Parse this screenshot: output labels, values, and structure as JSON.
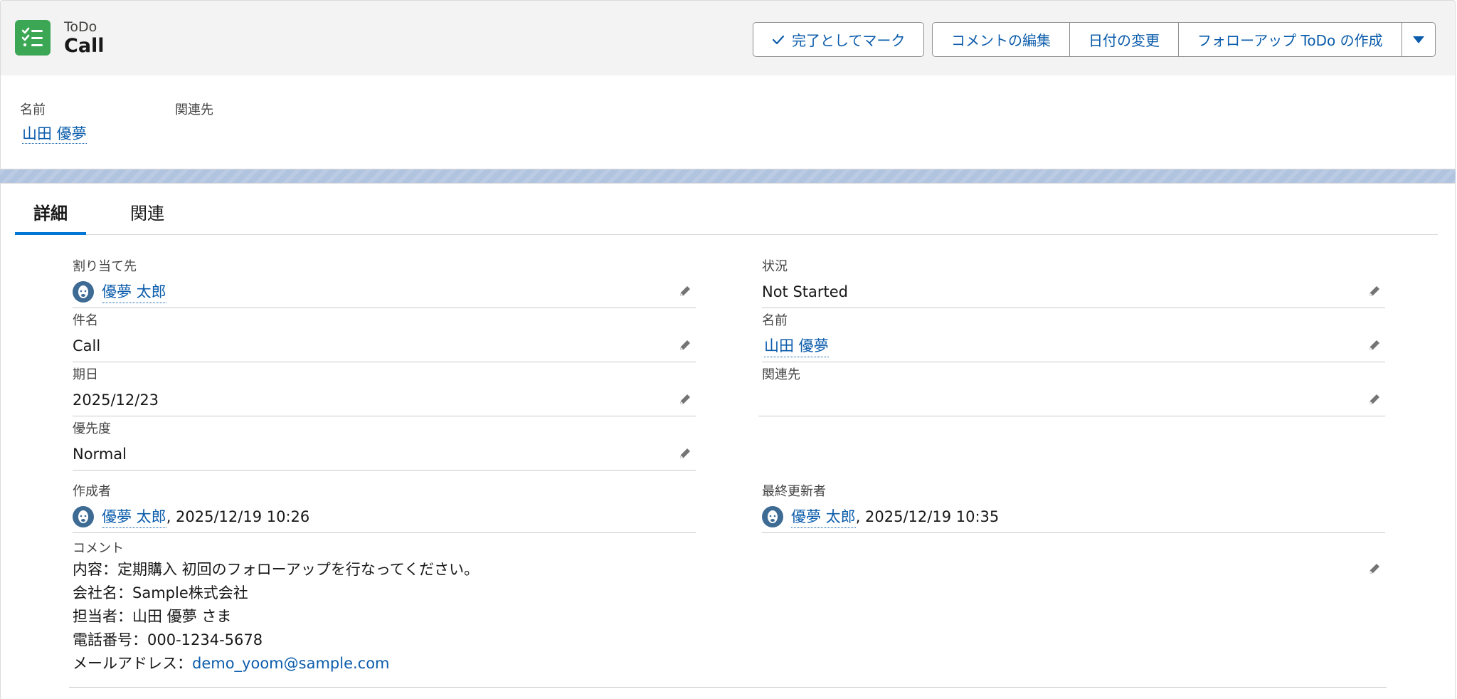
{
  "header": {
    "object_type": "ToDo",
    "title": "Call",
    "icon": "task-list-icon",
    "buttons": {
      "mark_complete": "完了としてマーク",
      "edit_comments": "コメントの編集",
      "change_date": "日付の変更",
      "create_followup": "フォローアップ ToDo の作成"
    }
  },
  "highlights": {
    "name_label": "名前",
    "name_value": "山田 優夢",
    "related_label": "関連先",
    "related_value": ""
  },
  "tabs": [
    "詳細",
    "関連"
  ],
  "details": {
    "assigned_to": {
      "label": "割り当て先",
      "value": "優夢 太郎"
    },
    "status": {
      "label": "状況",
      "value": "Not Started"
    },
    "subject": {
      "label": "件名",
      "value": "Call"
    },
    "name": {
      "label": "名前",
      "value": "山田 優夢"
    },
    "due_date": {
      "label": "期日",
      "value": "2025/12/23"
    },
    "related_to": {
      "label": "関連先",
      "value": ""
    },
    "priority": {
      "label": "優先度",
      "value": "Normal"
    },
    "created_by": {
      "label": "作成者",
      "user": "優夢 太郎",
      "timestamp": ", 2025/12/19 10:26"
    },
    "last_modified_by": {
      "label": "最終更新者",
      "user": "優夢 太郎",
      "timestamp": ", 2025/12/19 10:35"
    },
    "comments": {
      "label": "コメント",
      "lines": [
        "内容：定期購入 初回のフォローアップを行なってください。",
        "会社名：Sample株式会社",
        "担当者：山田 優夢 さま",
        "電話番号：000-1234-5678"
      ],
      "email_prefix": "メールアドレス：",
      "email": "demo_yoom@sample.com"
    }
  },
  "colors": {
    "brand_icon": "#3ba755",
    "link": "#0b5cab",
    "tab_active": "#0176d3",
    "band": "#b0c4df"
  }
}
